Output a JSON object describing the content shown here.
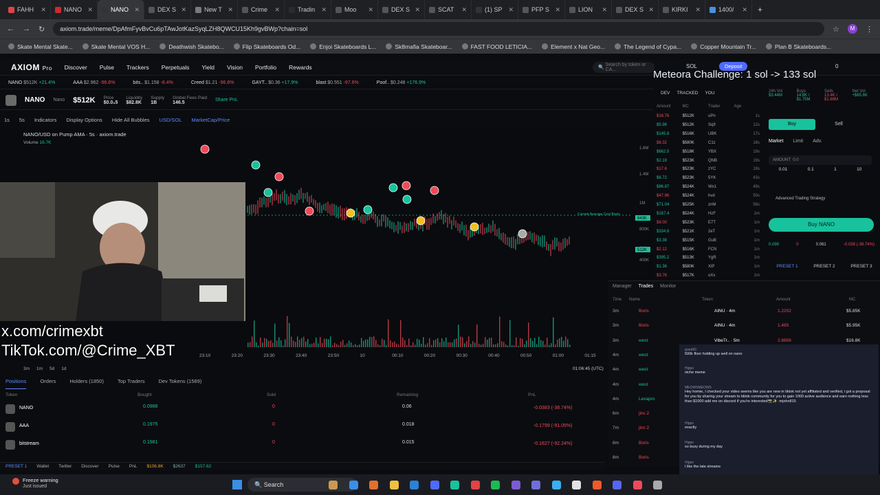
{
  "tabs": [
    {
      "label": "FAHH",
      "color": "#e04444"
    },
    {
      "label": "NANO",
      "color": "#cc2b2b"
    },
    {
      "label": "NANO",
      "color": "#333333",
      "active": true
    },
    {
      "label": "DEX S",
      "color": "#555555"
    },
    {
      "label": "New T",
      "color": "#7a7a7a"
    },
    {
      "label": "Crime",
      "color": "#555555"
    },
    {
      "label": "Tradin",
      "color": "#2b2b2b"
    },
    {
      "label": "Moo",
      "color": "#555555"
    },
    {
      "label": "DEX S",
      "color": "#555555"
    },
    {
      "label": "SCAT",
      "color": "#555555"
    },
    {
      "label": "(1) SP",
      "color": "#333333"
    },
    {
      "label": "PFP S",
      "color": "#555555"
    },
    {
      "label": "LION",
      "color": "#555555"
    },
    {
      "label": "DEX S",
      "color": "#555555"
    },
    {
      "label": "KIRKI",
      "color": "#555555"
    },
    {
      "label": "1400/",
      "color": "#4a90e2"
    }
  ],
  "url": "axiom.trade/meme/DpAfmFyvBvCu6pTAwJotKazSyqLZH8QWCU15Kh9gvBWp?chain=sol",
  "bookmarks": [
    "Skate Mental Skate...",
    "Skate Mental VOS H...",
    "Deathwish Skatebo...",
    "Flip Skateboards Od...",
    "Enjoi Skateboards L...",
    "Sk8mafia Skateboar...",
    "FAST FOOD LETICIA...",
    "Element x Nat Geo...",
    "The Legend of Cypa...",
    "Copper Mountain Tr...",
    "Plan B Skateboards..."
  ],
  "app": {
    "logo": "AXIOM",
    "logo_sub": "Pro",
    "nav": [
      "Discover",
      "Pulse",
      "Trackers",
      "Perpetuals",
      "Yield",
      "Vision",
      "Portfolio",
      "Rewards"
    ],
    "search_placeholder": "Search by token or CA...",
    "chain": "SOL",
    "deposit": "Deposit",
    "balance": "0"
  },
  "overlay_title": "Meteora Challenge: 1 sol -> 133 sol",
  "ticker": [
    {
      "name": "NANO",
      "val": "$512K",
      "chg": "+21.4%"
    },
    {
      "name": "AAA",
      "val": "$2.962",
      "chg": "-96.6%"
    },
    {
      "name": "bits..",
      "val": "$1.158",
      "chg": "-8.4%"
    },
    {
      "name": "Creed",
      "val": "$1.21",
      "chg": "-96.6%"
    },
    {
      "name": "GAYT..",
      "val": "$0.36",
      "chg": "+17.9%"
    },
    {
      "name": "blast",
      "val": "$0.551",
      "chg": "-97.6%"
    },
    {
      "name": "Poof..",
      "val": "$0.248",
      "chg": "+176.9%"
    }
  ],
  "token": {
    "symbol": "NANO",
    "name": "Nano",
    "mc": "$512K",
    "price_label": "Price",
    "price": "$0.0₃5",
    "liq_label": "Liquidity",
    "liq": "$82.8K",
    "supply_label": "Supply",
    "supply": "1B",
    "fees_label": "Global Fees Paid",
    "fees": "146.5",
    "share": "Share PnL"
  },
  "chart": {
    "tools": [
      "1s",
      "5s",
      "Indicators",
      "Display Options",
      "Hide All Bubbles",
      "USD/SOL",
      "MarketCap/Price"
    ],
    "title": "NANO/USD on Pump AMA · 5s · axiom.trade",
    "volume_label": "Volume",
    "volume": "16.7K",
    "y_labels": [
      "1.6M",
      "1.4M",
      "1M",
      "800K",
      "600K",
      "400K"
    ],
    "current_label": "843K",
    "last_label": "512K",
    "x_labels": [
      "23:10",
      "23:20",
      "23:30",
      "23:40",
      "23:50",
      "10",
      "00:10",
      "00:20",
      "00:30",
      "00:40",
      "00:50",
      "01:00",
      "01:15"
    ],
    "timestamp": "01:06:45 (UTC)",
    "ranges": [
      "3m",
      "1m",
      "5d",
      "1d"
    ],
    "avg_cost": "Current Average Cost Basis"
  },
  "overlays": {
    "x": "x.com/crimexbt",
    "tiktok": "TikTok.com/@Crime_XBT"
  },
  "bottom_tabs": [
    "Positions",
    "Orders",
    "Holders (1850)",
    "Top Traders",
    "Dev Tokens (1589)"
  ],
  "positions_header": [
    "Token",
    "Bought",
    "Sold",
    "Remaining",
    "PnL"
  ],
  "positions": [
    {
      "token": "NANO",
      "bought": "0.0988",
      "sold": "0",
      "remaining": "0.06",
      "pnl": "-0.0383 (-38.74%)"
    },
    {
      "token": "AAA",
      "bought": "0.1975",
      "sold": "0",
      "remaining": "0.018",
      "pnl": "-0.1799 (-91.05%)"
    },
    {
      "token": "bitstream",
      "bought": "0.1981",
      "sold": "0",
      "remaining": "0.015",
      "pnl": "-0.1827 (-92.24%)"
    }
  ],
  "trades_header": [
    "DEV",
    "TRACKED",
    "YOU"
  ],
  "trade_cols": [
    "Amount",
    "MC",
    "Trader",
    "Age"
  ],
  "trades": [
    {
      "amt": "$16.76",
      "mc": "$512K",
      "t": "uPn",
      "age": "1s"
    },
    {
      "amt": "$5.98",
      "mc": "$512K",
      "t": "Sq9",
      "age": "12s"
    },
    {
      "amt": "$145.8",
      "mc": "$516K",
      "t": "UBK",
      "age": "17s"
    },
    {
      "amt": "$8.32",
      "mc": "$580K",
      "t": "C1z",
      "age": "18s"
    },
    {
      "amt": "$662.5",
      "mc": "$518K",
      "t": "YBX",
      "age": "19s"
    },
    {
      "amt": "$2.19",
      "mc": "$523K",
      "t": "QNB",
      "age": "19s"
    },
    {
      "amt": "$17.6",
      "mc": "$523K",
      "t": "zYC",
      "age": "19s"
    },
    {
      "amt": "$6.72",
      "mc": "$523K",
      "t": "5YK",
      "age": "43s"
    },
    {
      "amt": "$86.87",
      "mc": "$524K",
      "t": "Wx1",
      "age": "49s"
    },
    {
      "amt": "$47.96",
      "mc": "$524K",
      "t": "hvd",
      "age": "50s"
    },
    {
      "amt": "$71.04",
      "mc": "$525K",
      "t": "znM",
      "age": "58s"
    },
    {
      "amt": "$167.4",
      "mc": "$524K",
      "t": "HzF",
      "age": "1m"
    },
    {
      "amt": "$9.00",
      "mc": "$523K",
      "t": "E7T",
      "age": "1m"
    },
    {
      "amt": "$334.8",
      "mc": "$521K",
      "t": "2eT",
      "age": "1m"
    },
    {
      "amt": "$3.38",
      "mc": "$515K",
      "t": "GuB",
      "age": "1m"
    },
    {
      "amt": "$2.12",
      "mc": "$516K",
      "t": "FCN",
      "age": "1m"
    },
    {
      "amt": "$395.2",
      "mc": "$513K",
      "t": "YgR",
      "age": "1m"
    },
    {
      "amt": "$1.36",
      "mc": "$580K",
      "t": "XiP",
      "age": "1m"
    },
    {
      "amt": "$3.76",
      "mc": "$517K",
      "t": "oXx",
      "age": "1m"
    }
  ],
  "buy": {
    "stats": [
      "24h Vol",
      "Buys",
      "Sells",
      "Net Vol"
    ],
    "stat_vals": [
      "$3.44M",
      "14.8K / $1.75M",
      "13.4K / $1.69M",
      "+$65.6K"
    ],
    "buy": "Buy",
    "sell": "Sell",
    "modes": [
      "Market",
      "Limit",
      "Adv."
    ],
    "amount_label": "AMOUNT",
    "amount": "0.0",
    "presets": [
      "0.01",
      "0.1",
      "1",
      "10"
    ],
    "advanced": "Advanced Trading Strategy",
    "buy_btn": "Buy NANO",
    "bought": "0.099",
    "sold": "0",
    "holding": "0.061",
    "pnl": "-0.038 (-38.74%)",
    "preset_tabs": [
      "PRESET 1",
      "PRESET 2",
      "PRESET 3"
    ]
  },
  "monitor": {
    "tabs": [
      "Manager",
      "Trades",
      "Monitor"
    ],
    "cols": [
      "Time",
      "Name",
      "Token",
      "Amount",
      "MC"
    ],
    "rows": [
      {
        "time": "3m",
        "name": "Boris",
        "token": "AINU · 4m",
        "amt": "1.2202",
        "mc": "$5.85K"
      },
      {
        "time": "3m",
        "name": "Boris",
        "token": "AINU · 4m",
        "amt": "1.485",
        "mc": "$5.95K"
      },
      {
        "time": "3m",
        "name": "west",
        "token": "VibeTr.. · 5m",
        "amt": "2.8856",
        "mc": "$16.8K"
      },
      {
        "time": "4m",
        "name": "west",
        "token": "",
        "amt": "",
        "mc": ""
      },
      {
        "time": "4m",
        "name": "west",
        "token": "",
        "amt": "",
        "mc": ""
      },
      {
        "time": "4m",
        "name": "west",
        "token": "",
        "amt": "",
        "mc": ""
      },
      {
        "time": "4m",
        "name": "Lexapro",
        "token": "",
        "amt": "",
        "mc": ""
      },
      {
        "time": "6m",
        "name": "jinc 2",
        "token": "",
        "amt": "",
        "mc": ""
      },
      {
        "time": "7m",
        "name": "jinc 2",
        "token": "",
        "amt": "",
        "mc": ""
      },
      {
        "time": "8m",
        "name": "Boris",
        "token": "",
        "amt": "",
        "mc": ""
      },
      {
        "time": "8m",
        "name": "Boris",
        "token": "",
        "amt": "",
        "mc": ""
      }
    ]
  },
  "chat": [
    {
      "user": "grant69",
      "text": "500k floor holding up well on nano"
    },
    {
      "user": "Hippo",
      "text": "niche meme"
    },
    {
      "user": "MEOWSMEOWS",
      "text": "Hey homie, I checked your video seems like you are new in tiktok not yet affiliated and verified, i got a proposal for you by sharing your stream to tiktok community for you to gain 1000 active audience and earn nothing less than $1000 add me on discord if you're interested📸✨ -mjohn815"
    },
    {
      "user": "Hippo",
      "text": "exactly"
    },
    {
      "user": "Hippo",
      "text": "so busy during my day"
    },
    {
      "user": "Hippo",
      "text": "I like the late streams"
    },
    {
      "user": "Hippo",
      "text": "👍"
    }
  ],
  "bottombar": {
    "preset": "PRESET 1",
    "items": [
      "Wallet",
      "Twitter",
      "Discover",
      "Pulse",
      "PnL"
    ],
    "sol": "$106.8K",
    "eth": "$2637",
    "btc": "$157.62"
  },
  "taskbar": {
    "warning": "Freeze warning",
    "warning_sub": "Just issued",
    "search": "Search"
  }
}
